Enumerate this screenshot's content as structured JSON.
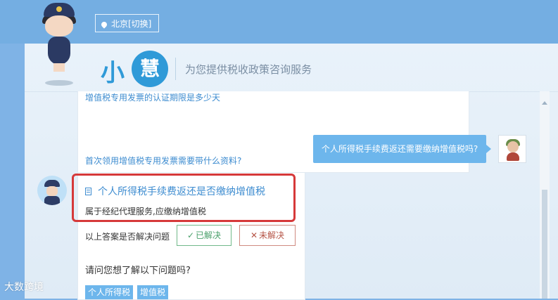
{
  "location": {
    "label": "北京[切换]"
  },
  "header": {
    "logo_small": "小",
    "logo_circle": "慧",
    "slogan": "为您提供税收政策咨询服务"
  },
  "history": {
    "links": [
      "增值税专用发票的认证期限是多少天",
      "首次领用增值税专用发票需要带什么资料?"
    ]
  },
  "user_message": "个人所得税手续费返还需要缴纳增值税吗?",
  "answer": {
    "title": "个人所得税手续费返还是否缴纳增值税",
    "text": "属于经纪代理服务,应缴纳增值税",
    "feedback_question": "以上答案是否解决问题",
    "resolved_label": "已解决",
    "unresolved_label": "未解决",
    "more_question": "请问您想了解以下问题吗?",
    "tags": [
      "个人所得税",
      "增值税"
    ]
  },
  "icons": {
    "location": "location-pin-icon",
    "check": "check-icon",
    "cross": "cross-icon",
    "document": "document-icon"
  },
  "colors": {
    "accent": "#3d8cd0",
    "highlight": "#d6393a",
    "resolved": "#4aa06b",
    "unresolved": "#b65547",
    "topbar": "#74aee2"
  },
  "watermark": "大数跨境"
}
